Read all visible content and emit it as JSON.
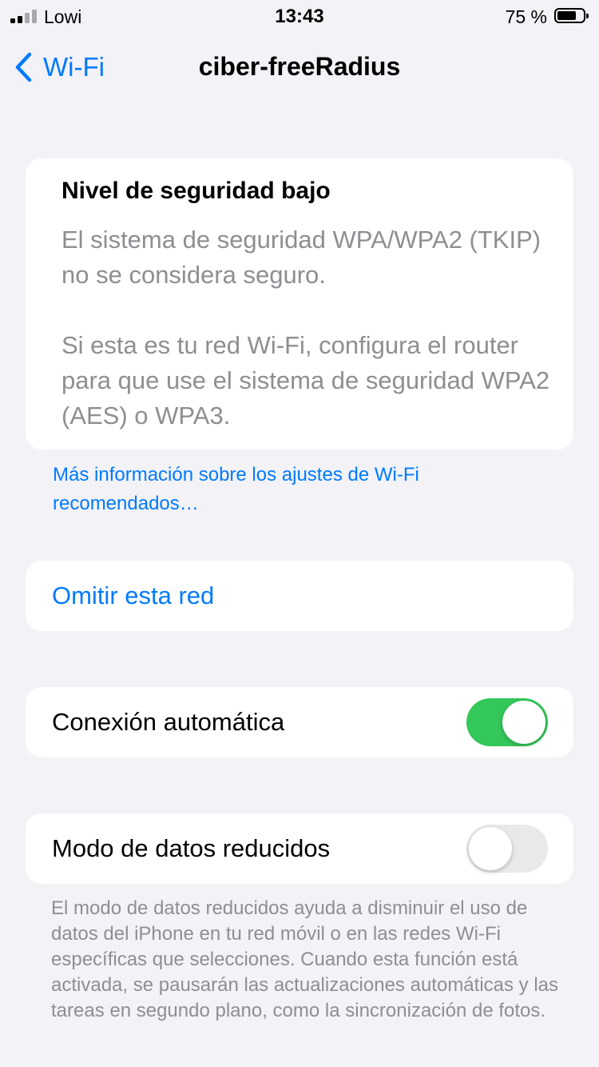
{
  "status_bar": {
    "carrier": "Lowi",
    "time": "13:43",
    "battery_percent": "75 %",
    "battery_level": 0.75,
    "signal_bars_active": 2,
    "signal_bars_total": 4
  },
  "nav": {
    "back_label": "Wi-Fi",
    "back_icon": "chevron-left-icon",
    "title": "ciber-freeRadius"
  },
  "security_warning": {
    "title": "Nivel de seguridad bajo",
    "paragraph_1": "El sistema de seguridad WPA/WPA2 (TKIP) no se considera seguro.",
    "paragraph_2": "Si esta es tu red Wi-Fi, configura el router para que use el sistema de seguridad WPA2 (AES) o WPA3."
  },
  "info_link": "Más información sobre los ajustes de Wi-Fi recomendados…",
  "forget_network": {
    "label": "Omitir esta red"
  },
  "auto_join": {
    "label": "Conexión automática",
    "enabled": true
  },
  "low_data_mode": {
    "label": "Modo de datos reducidos",
    "enabled": false,
    "footnote": "El modo de datos reducidos ayuda a disminuir el uso de datos del iPhone en tu red móvil o en las redes Wi-Fi específicas que selecciones. Cuando esta función está activada, se pausarán las actualizaciones automáticas y las tareas en segundo plano, como la sincronización de fotos."
  },
  "colors": {
    "accent": "#007aff",
    "toggle_on": "#34c759",
    "toggle_off": "#e9e9eb",
    "secondary_text": "#8e8e93",
    "background": "#f2f2f7",
    "signal_active": "#000000",
    "signal_inactive": "#a8a8ad"
  }
}
